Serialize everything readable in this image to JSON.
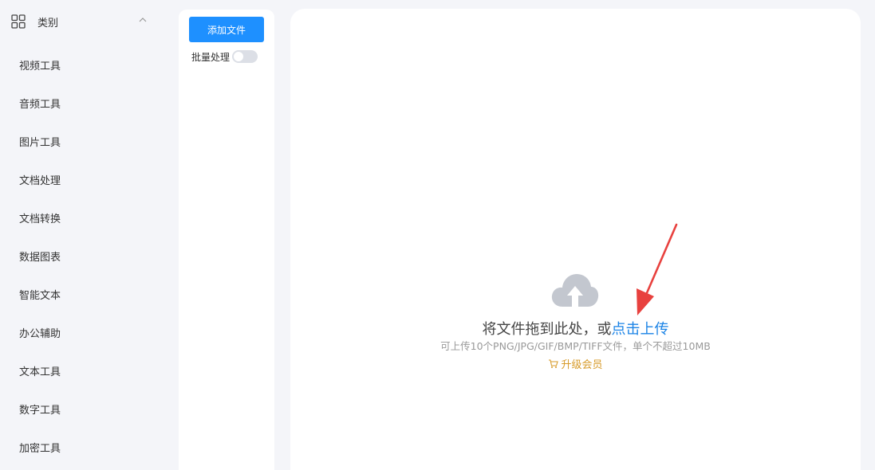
{
  "sidebar": {
    "category_title": "类别",
    "items": [
      {
        "label": "视频工具"
      },
      {
        "label": "音频工具"
      },
      {
        "label": "图片工具"
      },
      {
        "label": "文档处理"
      },
      {
        "label": "文档转换"
      },
      {
        "label": "数据图表"
      },
      {
        "label": "智能文本"
      },
      {
        "label": "办公辅助"
      },
      {
        "label": "文本工具"
      },
      {
        "label": "数字工具"
      },
      {
        "label": "加密工具"
      }
    ]
  },
  "toolbar": {
    "add_file_label": "添加文件",
    "batch_label": "批量处理",
    "batch_enabled": false
  },
  "upload": {
    "drop_text": "将文件拖到此处，或",
    "click_upload": "点击上传",
    "hint": "可上传10个PNG/JPG/GIF/BMP/TIFF文件，单个不超过10MB",
    "upgrade_label": "升级会员"
  },
  "icons": {
    "category": "grid-icon",
    "collapse": "chevron-up-icon",
    "upload": "cloud-upload-icon",
    "upgrade": "cart-icon"
  },
  "colors": {
    "primary": "#1e90ff",
    "link": "#1a83e6",
    "upgrade": "#d79b2a",
    "annotation": "#e8413e",
    "background": "#f4f5f9"
  }
}
